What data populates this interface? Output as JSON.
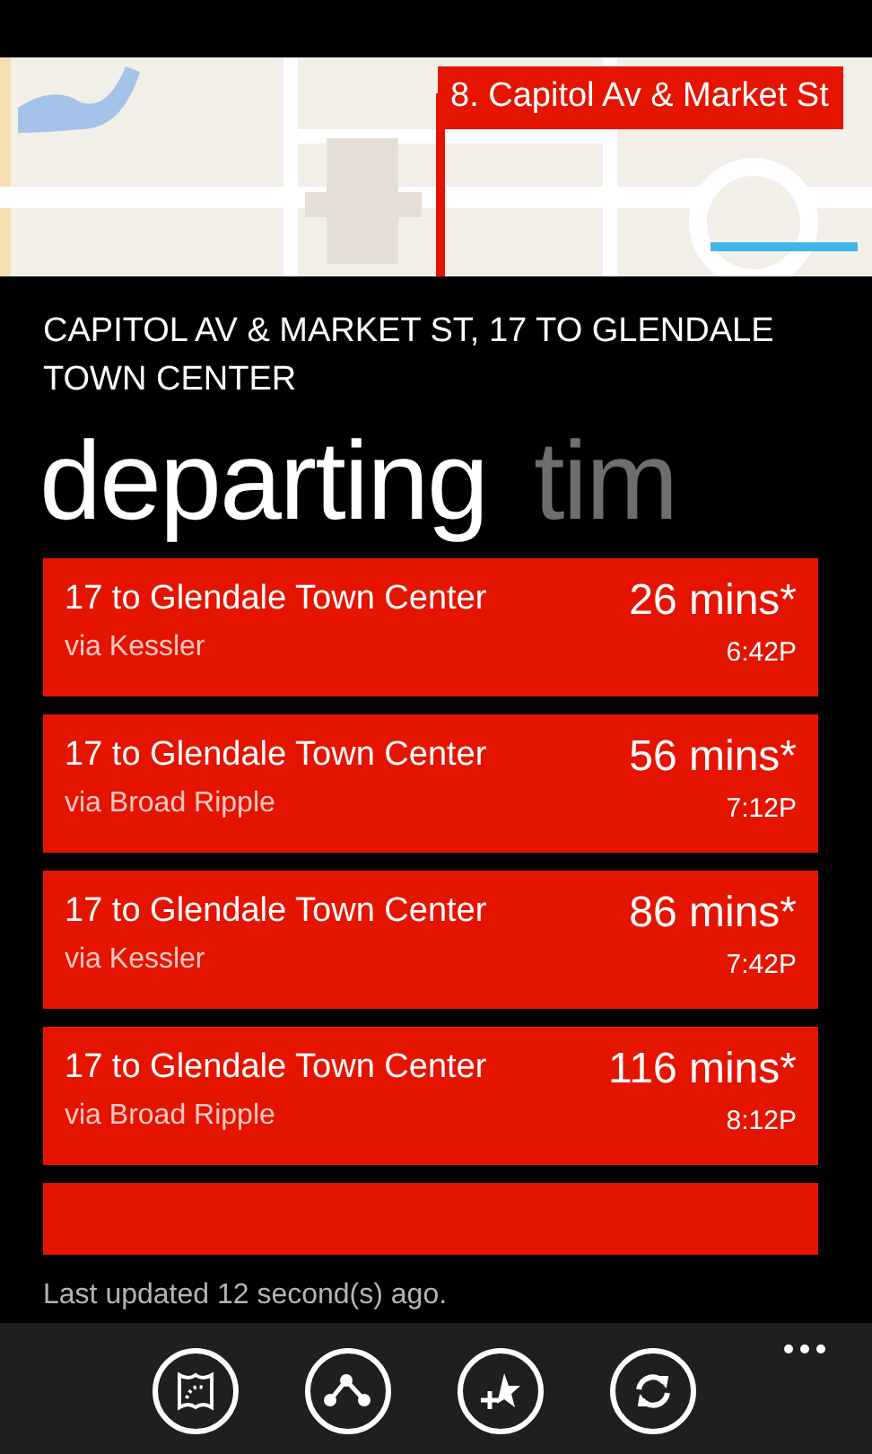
{
  "map": {
    "kind": "picture",
    "callout": "8. Capitol Av & Market St"
  },
  "stop_title": "CAPITOL AV & MARKET ST, 17 TO GLENDALE TOWN CENTER",
  "pivot": [
    {
      "label": "departing",
      "selected": true
    },
    {
      "label": "tim",
      "selected": false
    }
  ],
  "departures": [
    {
      "route": "17 to Glendale Town Center",
      "via": "via Kessler",
      "eta": "26 mins*",
      "time": "6:42P"
    },
    {
      "route": "17 to Glendale Town Center",
      "via": "via Broad Ripple",
      "eta": "56 mins*",
      "time": "7:12P"
    },
    {
      "route": "17 to Glendale Town Center",
      "via": "via Kessler",
      "eta": "86 mins*",
      "time": "7:42P"
    },
    {
      "route": "17 to Glendale Town Center",
      "via": "via Broad Ripple",
      "eta": "116 mins*",
      "time": "8:12P"
    }
  ],
  "more_departures_below": true,
  "last_updated": "Last updated 12 second(s) ago.",
  "app_bar": {
    "buttons": [
      {
        "kind": "map"
      },
      {
        "kind": "route"
      },
      {
        "kind": "favorite"
      },
      {
        "kind": "refresh"
      }
    ],
    "more_menu": true
  }
}
